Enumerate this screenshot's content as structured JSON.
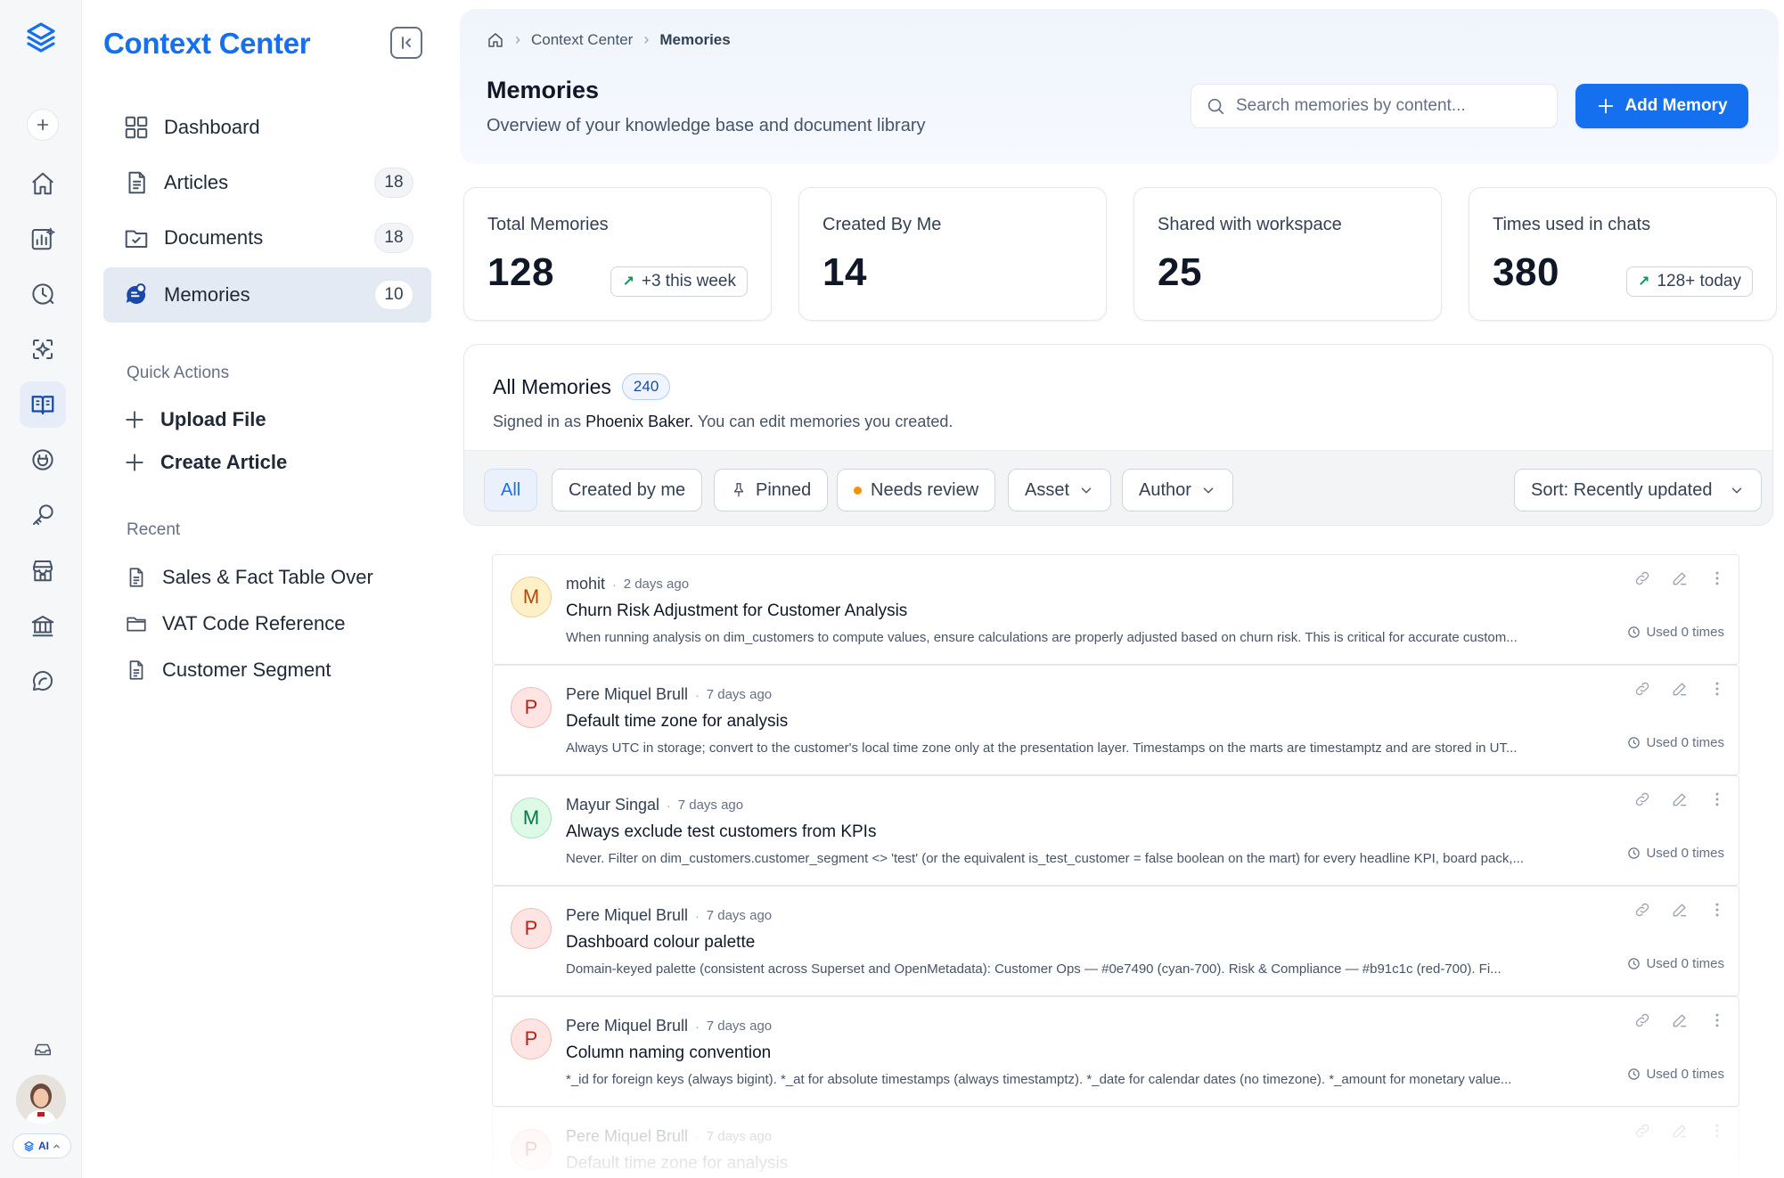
{
  "app": {
    "title": "Context Center"
  },
  "rail": {
    "ai_label": "AI"
  },
  "sidebar": {
    "nav": [
      {
        "label": "Dashboard",
        "icon": "grid-icon",
        "count": ""
      },
      {
        "label": "Articles",
        "icon": "article-icon",
        "count": "18"
      },
      {
        "label": "Documents",
        "icon": "folder-check-icon",
        "count": "18"
      },
      {
        "label": "Memories",
        "icon": "memory-icon",
        "count": "10"
      }
    ],
    "quick_actions_label": "Quick Actions",
    "quick_actions": [
      "Upload File",
      "Create Article"
    ],
    "recent_label": "Recent",
    "recent": [
      {
        "label": "Sales & Fact Table Over",
        "icon": "file-icon"
      },
      {
        "label": "VAT Code Reference",
        "icon": "folder-icon"
      },
      {
        "label": "Customer Segment",
        "icon": "file-icon"
      }
    ]
  },
  "header": {
    "breadcrumb": [
      "Context Center",
      "Memories"
    ],
    "title": "Memories",
    "subtitle": "Overview of your knowledge base and document library",
    "search_placeholder": "Search memories by content...",
    "add_label": "Add Memory"
  },
  "stats": [
    {
      "label": "Total Memories",
      "value": "128",
      "trend": "+3 this week"
    },
    {
      "label": "Created By Me",
      "value": "14",
      "trend": ""
    },
    {
      "label": "Shared with workspace",
      "value": "25",
      "trend": ""
    },
    {
      "label": "Times used in chats",
      "value": "380",
      "trend": "128+ today"
    }
  ],
  "list": {
    "title": "All Memories",
    "count": "240",
    "signed_in_prefix": "Signed in as",
    "user": "Phoenix Baker.",
    "signed_in_suffix": "You can edit memories you created.",
    "filters": {
      "all": "All",
      "created_by_me": "Created by me",
      "pinned": "Pinned",
      "needs_review": "Needs review",
      "asset": "Asset",
      "author": "Author",
      "sort": "Sort: Recently updated"
    }
  },
  "memories": [
    {
      "initial": "M",
      "author": "mohit",
      "ago": "2 days ago",
      "title": "Churn Risk Adjustment for Customer Analysis",
      "body": "When running analysis on dim_customers to compute values, ensure calculations are properly adjusted based on churn risk. This is critical for accurate custom...",
      "used": "Used 0 times",
      "avatar_bg": "#fef0c7",
      "avatar_fg": "#b54708"
    },
    {
      "initial": "P",
      "author": "Pere Miquel Brull",
      "ago": "7 days ago",
      "title": "Default time zone for analysis",
      "body": "Always UTC in storage; convert to the customer's local time zone only at the presentation layer. Timestamps on the marts are timestamptz and are stored in UT...",
      "used": "Used 0 times",
      "avatar_bg": "#fee4e2",
      "avatar_fg": "#b42318"
    },
    {
      "initial": "M",
      "author": "Mayur Singal",
      "ago": "7 days ago",
      "title": "Always exclude test customers from KPIs",
      "body": "Never. Filter on dim_customers.customer_segment <> 'test' (or the equivalent is_test_customer = false boolean on the mart) for every headline KPI, board pack,...",
      "used": "Used 0 times",
      "avatar_bg": "#dcfae6",
      "avatar_fg": "#067647"
    },
    {
      "initial": "P",
      "author": "Pere Miquel Brull",
      "ago": "7 days ago",
      "title": "Dashboard colour palette",
      "body": "Domain-keyed palette (consistent across Superset and OpenMetadata): Customer Ops — #0e7490 (cyan-700). Risk & Compliance — #b91c1c (red-700). Fi...",
      "used": "Used 0 times",
      "avatar_bg": "#fee4e2",
      "avatar_fg": "#b42318"
    },
    {
      "initial": "P",
      "author": "Pere Miquel Brull",
      "ago": "7 days ago",
      "title": "Column naming convention",
      "body": "*_id for foreign keys (always bigint). *_at for absolute timestamps (always timestamptz). *_date for calendar dates (no timezone). *_amount for monetary value...",
      "used": "Used 0 times",
      "avatar_bg": "#fee4e2",
      "avatar_fg": "#b42318"
    },
    {
      "initial": "P",
      "author": "Pere Miquel Brull",
      "ago": "7 days ago",
      "title": "Default time zone for analysis",
      "body": "",
      "used": "",
      "avatar_bg": "#fee4e2",
      "avatar_fg": "#b42318"
    }
  ],
  "colors": {
    "accent": "#1570ef",
    "active_nav": "#e4eaf3"
  }
}
